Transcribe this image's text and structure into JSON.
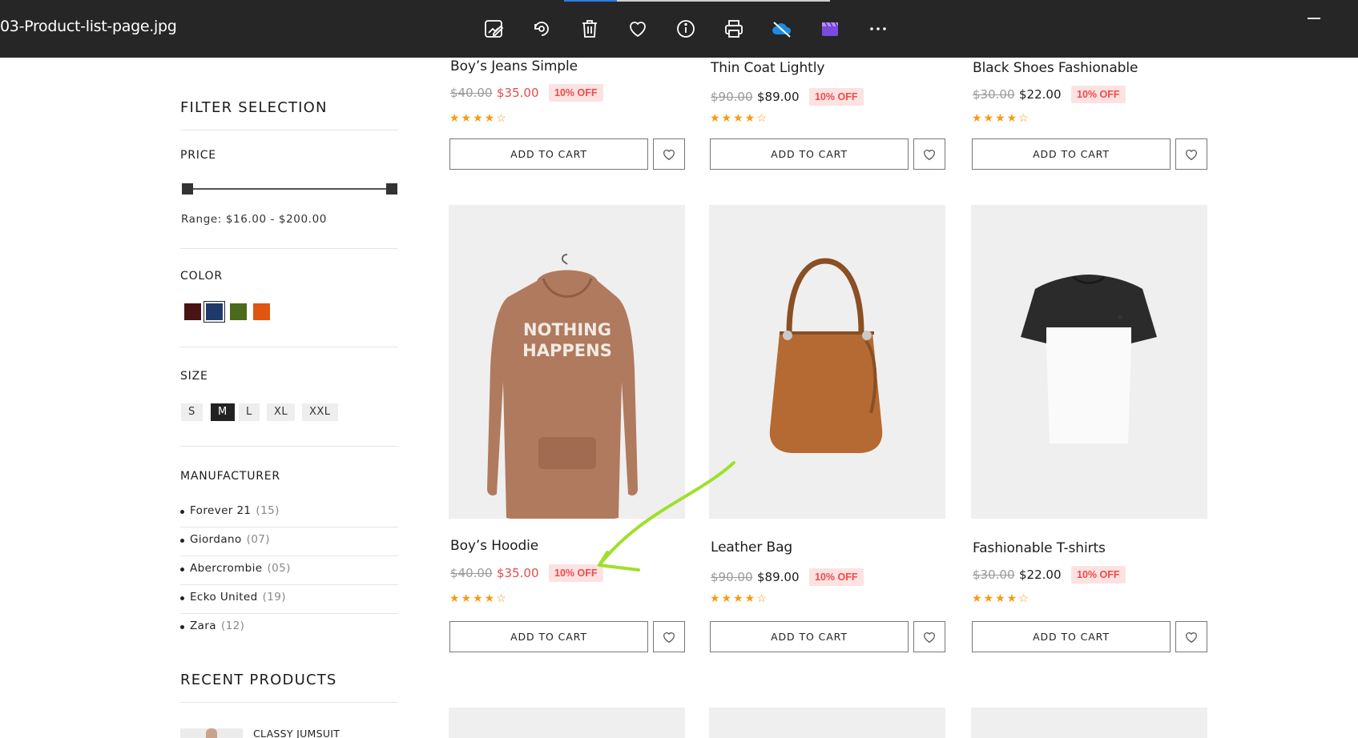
{
  "viewer": {
    "file_name": "03-Product-list-page.jpg",
    "progress": 0.2,
    "toolbar_icons": [
      "edit-image-icon",
      "rotate-icon",
      "delete-icon",
      "favorite-icon",
      "info-icon",
      "print-icon",
      "onedrive-icon",
      "clipchamp-icon",
      "more-icon"
    ]
  },
  "sidebar": {
    "heading": "FILTER SELECTION",
    "price": {
      "label": "PRICE",
      "range_text": "Range: $16.00  -  $200.00",
      "min": "$16.00",
      "max": "$200.00"
    },
    "color": {
      "label": "COLOR",
      "swatches": [
        "#4a1414",
        "#1d3a6b",
        "#4a6b1a",
        "#e0550f"
      ],
      "selected_index": 1
    },
    "size": {
      "label": "SIZE",
      "options": [
        "S",
        "M",
        "L",
        "XL",
        "XXL"
      ],
      "selected": "M"
    },
    "manufacturer": {
      "label": "MANUFACTURER",
      "items": [
        {
          "name": "Forever 21",
          "count": "(15)"
        },
        {
          "name": "Giordano",
          "count": "(07)"
        },
        {
          "name": "Abercrombie",
          "count": "(05)"
        },
        {
          "name": "Ecko United",
          "count": "(19)"
        },
        {
          "name": "Zara",
          "count": "(12)"
        }
      ]
    },
    "recent": {
      "label": "RECENT PRODUCTS",
      "first_item": "CLASSY JUMSUIT"
    }
  },
  "products": [
    {
      "title": "Boy’s Jeans Simple",
      "old_price": "$40.00",
      "new_price": "$35.00",
      "badge": "10% OFF",
      "rating": 4,
      "price_color": "#e94b4b",
      "cart_label": "ADD TO CART"
    },
    {
      "title": "Thin Coat Lightly",
      "old_price": "$90.00",
      "new_price": "$89.00",
      "badge": "10% OFF",
      "rating": 4,
      "price_color": "#1c1c1c",
      "cart_label": "ADD TO CART"
    },
    {
      "title": "Black Shoes Fashionable",
      "old_price": "$30.00",
      "new_price": "$22.00",
      "badge": "10% OFF",
      "rating": 4,
      "price_color": "#1c1c1c",
      "cart_label": "ADD TO CART"
    },
    {
      "title": "Boy’s Hoodie",
      "old_price": "$40.00",
      "new_price": "$35.00",
      "badge": "10% OFF",
      "rating": 4,
      "price_color": "#e94b4b",
      "cart_label": "ADD TO CART",
      "image_text": [
        "NOTHING",
        "HAPPENS"
      ]
    },
    {
      "title": "Leather Bag",
      "old_price": "$90.00",
      "new_price": "$89.00",
      "badge": "10% OFF",
      "rating": 4,
      "price_color": "#1c1c1c",
      "cart_label": "ADD TO CART"
    },
    {
      "title": "Fashionable T-shirts",
      "old_price": "$30.00",
      "new_price": "$22.00",
      "badge": "10% OFF",
      "rating": 4,
      "price_color": "#1c1c1c",
      "cart_label": "ADD TO CART"
    }
  ],
  "annotation": {
    "color": "#9ee02a"
  }
}
